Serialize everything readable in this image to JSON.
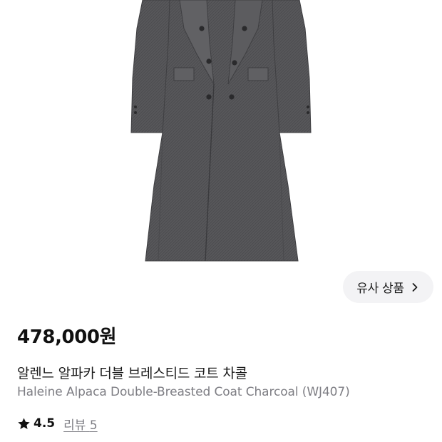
{
  "product": {
    "image_icon": "coat-product-image",
    "price": "478,000원",
    "title_ko": "알렌느 알파카 더블 브레스티드 코트 차콜",
    "title_en": "Haleine Alpaca Double-Breasted Coat Charcoal (WJ407)",
    "rating": "4.5",
    "review_label": "리뷰",
    "review_count": "5"
  },
  "similar_button": {
    "label": "유사 상품",
    "icon": "chevron-right-icon"
  },
  "colors": {
    "coat": "#57575a",
    "coat_dark": "#3e3e41",
    "button_bg": "#f3f3f5",
    "secondary_text": "#7e7e84"
  }
}
